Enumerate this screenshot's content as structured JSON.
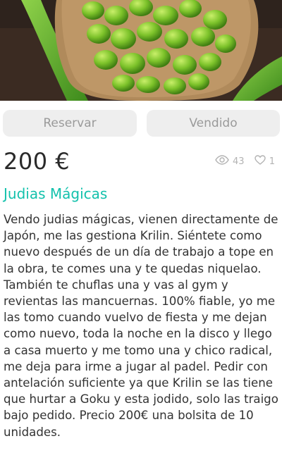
{
  "listing": {
    "reserve_label": "Reservar",
    "sold_label": "Vendido",
    "price": "200 €",
    "views": "43",
    "likes": "1",
    "title": "Judias Mágicas",
    "description": "Vendo judias mágicas, vienen directamente de Japón, me las gestiona Krilin. Siéntete como nuevo después de un día de trabajo a tope en la obra, te comes una y te quedas niquelao. También te chuflas una y vas al gym y revientas las mancuernas. 100% fiable, yo me las tomo cuando vuelvo de fiesta y me dejan como nuevo, toda la noche en la disco y llego a casa muerto y me tomo una y chico radical, me deja para irme a jugar al padel. Pedir con antelación suficiente ya que Krilin se las tiene que hurtar a Goku y esta jodido, solo las traigo bajo pedido. Precio 200€ una bolsita de 10 unidades."
  },
  "icons": {
    "views": "eye-icon",
    "likes": "heart-icon"
  },
  "colors": {
    "accent": "#13c1ac",
    "button_bg": "#eeeeee",
    "button_text": "#9a9a9a",
    "price_text": "#2a2a2a"
  }
}
